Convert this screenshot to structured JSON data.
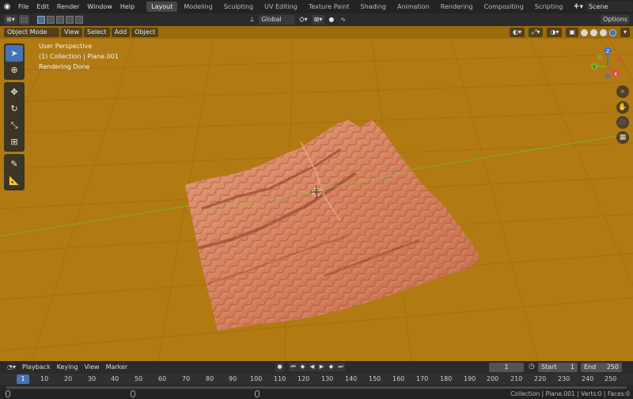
{
  "menu": {
    "items": [
      "File",
      "Edit",
      "Render",
      "Window",
      "Help"
    ],
    "workspaces": [
      "Layout",
      "Modeling",
      "Sculpting",
      "UV Editing",
      "Texture Paint",
      "Shading",
      "Animation",
      "Rendering",
      "Compositing",
      "Scripting"
    ],
    "add_symbol": "+",
    "scene_label": "Scene"
  },
  "tool_header": {
    "orientation": "Global",
    "options": "Options"
  },
  "viewport_header": {
    "mode": "Object Mode",
    "menus": [
      "View",
      "Select",
      "Add",
      "Object"
    ]
  },
  "viewport": {
    "overlay_lines": [
      "User Perspective",
      "(1) Collection | Plane.001",
      "Rendering Done"
    ],
    "background_color": "#b17a13",
    "terrain_color": "#d98764",
    "gizmo": {
      "x": "X",
      "y": "Y",
      "z": "Z"
    }
  },
  "timeline": {
    "menus": [
      "Playback",
      "Keying",
      "View",
      "Marker"
    ],
    "current_frame": "1",
    "start_label": "Start",
    "start_value": "1",
    "end_label": "End",
    "end_value": "250",
    "ruler": [
      "1",
      "10",
      "20",
      "30",
      "40",
      "50",
      "60",
      "70",
      "80",
      "90",
      "100",
      "110",
      "120",
      "130",
      "140",
      "150",
      "160",
      "170",
      "180",
      "190",
      "200",
      "210",
      "220",
      "230",
      "240",
      "250"
    ]
  },
  "status": {
    "text": "Collection | Plane.001 | Verts:0 | Faces:0"
  }
}
